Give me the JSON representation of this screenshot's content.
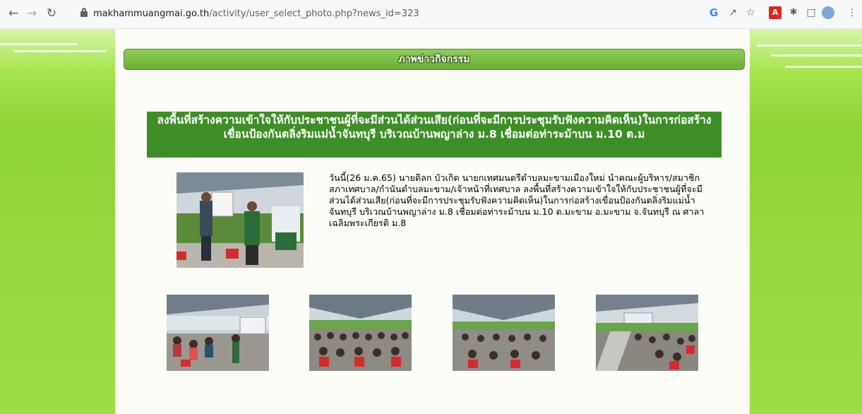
{
  "browser": {
    "url_domain": "makhammuangmai.go.th",
    "url_path": "/activity/user_select_photo.php?news_id=323",
    "icons": [
      "back-icon",
      "forward-icon",
      "reload-icon",
      "lock-icon",
      "google-icon",
      "share-icon",
      "star-icon",
      "pdf-extension-icon",
      "puzzle-extension-icon",
      "side-panel-icon",
      "profile-avatar-icon",
      "more-menu-icon"
    ]
  },
  "page": {
    "section_header": "ภาพข่าวกิจกรรม",
    "news_title": "ลงพื้นที่สร้างความเข้าใจให้กับประชาชนผู้ที่จะมีส่วนได้ส่วนเสีย(ก่อนที่จะมีการประชุมรับฟังความคิดเห็น)ในการก่อสร้างเขื่อนป้องกันตลิ่งริมแม่น้ำจันทบุรี บริเวณบ้านพญาล่าง ม.8 เชื่อมต่อท่าระม้าบน ม.10 ต.ม",
    "news_body": "วันนี้(26 ม.ค.65) นายดิลก บัวเกิด นายกเทศมนตรีตำบลมะขามเมืองใหม่ นำคณะผู้บริหาร/สมาชิกสภาเทศบาล/กำนันตำบลมะขาม/เจ้าหน้าที่เทศบาล ลงพื้นที่สร้างความเข้าใจให้กับประชาชนผู้ที่จะมีส่วนได้ส่วนเสีย(ก่อนที่จะมีการประชุมรับฟังความคิดเห็น)ในการก่อสร้างเขื่อนป้องกันตลิ่งริมแม่น้ำจันทบุรี บริเวณบ้านพญาล่าง ม.8 เชื่อมต่อท่าระม้าบน ม.10 ต.มะขาม อ.มะขาม จ.จันทบุรี ณ ศาลาเฉลิมพระเกียรติ ม.8"
  },
  "colors": {
    "side_green": "#9ddd45",
    "header_green": "#6aae35",
    "title_green": "#3e8e27",
    "content_bg": "#fdfdf7"
  }
}
